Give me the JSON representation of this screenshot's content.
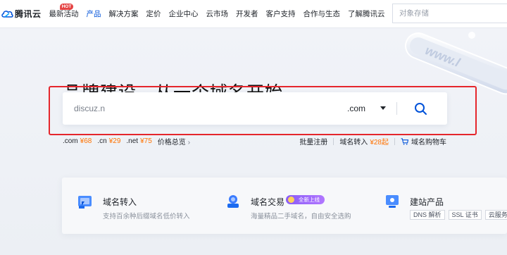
{
  "brand": {
    "name": "腾讯云"
  },
  "nav": {
    "items": [
      {
        "label": "最新活动",
        "badge": "HOT",
        "active": false
      },
      {
        "label": "产品",
        "active": true
      },
      {
        "label": "解决方案",
        "active": false
      },
      {
        "label": "定价",
        "active": false
      },
      {
        "label": "企业中心",
        "active": false
      },
      {
        "label": "云市场",
        "active": false
      },
      {
        "label": "开发者",
        "active": false
      },
      {
        "label": "客户支持",
        "active": false
      },
      {
        "label": "合作与生态",
        "active": false
      },
      {
        "label": "了解腾讯云",
        "active": false
      }
    ],
    "search_placeholder": "对象存储"
  },
  "hero": {
    "title": "品牌建设，从一个域名开始",
    "search": {
      "value": "discuz.n",
      "suffix": ".com",
      "button_icon": "search-icon"
    },
    "prices": [
      {
        "suffix": ".com",
        "price": "¥68"
      },
      {
        "suffix": ".cn",
        "price": "¥29"
      },
      {
        "suffix": ".net",
        "price": "¥75"
      }
    ],
    "price_all_label": "价格总览",
    "quick_links": {
      "bulk": "批量注册",
      "transfer": "域名转入",
      "transfer_price": "¥28起",
      "cart": "域名购物车"
    },
    "highlight_color": "#e5262c"
  },
  "cards": [
    {
      "title": "域名转入",
      "desc": "支持百余种后缀域名低价转入",
      "icon": "transfer-in-icon"
    },
    {
      "title": "域名交易",
      "badge": "全新上线",
      "desc": "海量精品二手域名，自由安全选购",
      "icon": "domain-trade-icon"
    },
    {
      "title": "建站产品",
      "tags": [
        "DNS 解析",
        "SSL 证书",
        "云服务"
      ],
      "icon": "site-build-icon"
    }
  ],
  "colors": {
    "accent": "#0052d9",
    "price": "#ff7200",
    "hot": "#e54545"
  }
}
